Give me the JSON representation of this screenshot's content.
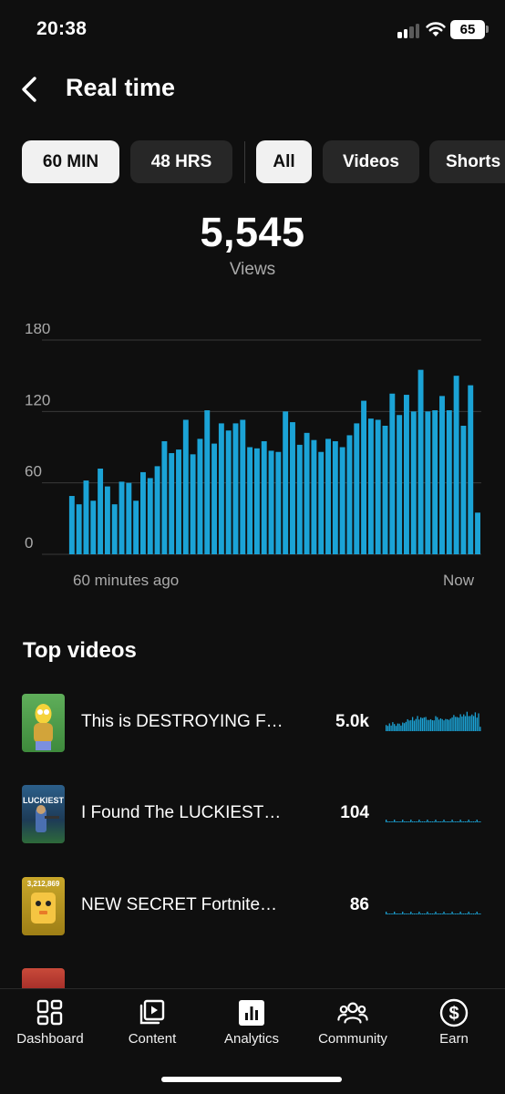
{
  "status_bar": {
    "time": "20:38",
    "battery": "65"
  },
  "header": {
    "title": "Real time"
  },
  "filters": {
    "time_ranges": [
      "60 MIN",
      "48 HRS"
    ],
    "content_types": [
      "All",
      "Videos",
      "Shorts"
    ],
    "active_time_range": "60 MIN",
    "active_content_type": "All"
  },
  "summary": {
    "total": "5,545",
    "label": "Views"
  },
  "chart_data": {
    "type": "bar",
    "x_start_label": "60 minutes ago",
    "x_end_label": "Now",
    "y_ticks": [
      0,
      60,
      120,
      180
    ],
    "ylim": [
      0,
      180
    ],
    "bar_color": "#1ba3d6",
    "values": [
      49,
      42,
      62,
      45,
      72,
      57,
      42,
      61,
      60,
      45,
      69,
      64,
      74,
      95,
      85,
      88,
      113,
      84,
      97,
      121,
      93,
      110,
      104,
      110,
      113,
      90,
      89,
      95,
      87,
      86,
      120,
      111,
      92,
      102,
      96,
      86,
      97,
      95,
      90,
      100,
      110,
      129,
      114,
      113,
      108,
      135,
      117,
      134,
      120,
      155,
      120,
      121,
      133,
      121,
      150,
      108,
      142,
      35
    ]
  },
  "top_videos": {
    "title": "Top videos",
    "items": [
      {
        "title": "This is DESTROYING Fortnite",
        "display_title": "This is DESTROYING F…",
        "views": "5.0k",
        "thumb_text": ""
      },
      {
        "title": "I Found The LUCKIEST",
        "display_title": "I Found The LUCKIEST…",
        "views": "104",
        "thumb_text": "LUCKIEST"
      },
      {
        "title": "NEW SECRET Fortnite",
        "display_title": "NEW SECRET Fortnite…",
        "views": "86",
        "thumb_text": "3,212,869"
      }
    ]
  },
  "bottom_nav": {
    "items": [
      {
        "label": "Dashboard",
        "icon": "dashboard-icon"
      },
      {
        "label": "Content",
        "icon": "content-icon"
      },
      {
        "label": "Analytics",
        "icon": "analytics-icon",
        "active": true
      },
      {
        "label": "Community",
        "icon": "community-icon"
      },
      {
        "label": "Earn",
        "icon": "earn-icon"
      }
    ]
  },
  "colors": {
    "background": "#0f0f0f",
    "accent": "#1ba3d6",
    "chip": "#272727",
    "chip_active": "#f1f1f1"
  }
}
